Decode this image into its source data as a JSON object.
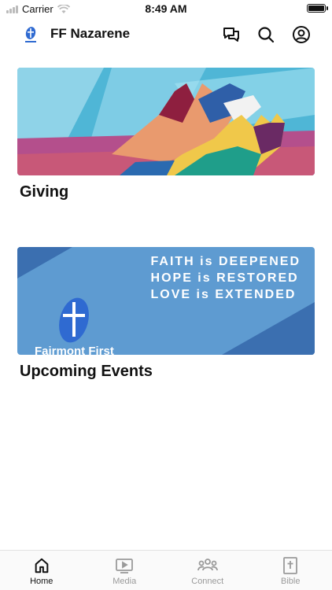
{
  "status_bar": {
    "carrier": "Carrier",
    "time": "8:49 AM"
  },
  "header": {
    "title": "FF Nazarene",
    "logo_icon": "church-cross-logo-icon",
    "actions": [
      {
        "name": "chat-icon"
      },
      {
        "name": "search-icon"
      },
      {
        "name": "account-icon"
      }
    ]
  },
  "cards": [
    {
      "label": "Giving",
      "image": "painted-hands-mural"
    },
    {
      "label": "Upcoming Events",
      "image_text": [
        "FAITH is DEEPENED",
        "HOPE is RESTORED",
        "LOVE is EXTENDED"
      ],
      "image_caption": "Fairmont First"
    }
  ],
  "tabbar": {
    "active": "Home",
    "tabs": [
      {
        "label": "Home",
        "icon": "home-icon"
      },
      {
        "label": "Media",
        "icon": "play-icon"
      },
      {
        "label": "Connect",
        "icon": "people-icon"
      },
      {
        "label": "Bible",
        "icon": "bible-icon"
      }
    ]
  },
  "colors": {
    "events_bg": "#5e9bd1",
    "events_dark": "#3b6fb0",
    "logo_blue": "#2f6ad1",
    "tab_inactive": "#9a9a9a"
  }
}
